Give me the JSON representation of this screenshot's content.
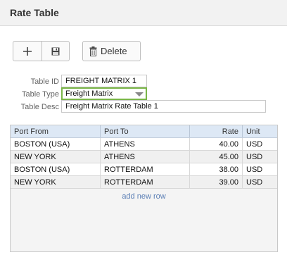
{
  "window": {
    "title": "Rate Table"
  },
  "toolbar": {
    "add_icon": "plus-icon",
    "save_icon": "floppy-disk-icon",
    "delete_icon": "trash-icon",
    "delete_label": "Delete"
  },
  "form": {
    "table_id_label": "Table ID",
    "table_id_value": "FREIGHT MATRIX 1",
    "table_type_label": "Table Type",
    "table_type_value": "Freight Matrix",
    "table_desc_label": "Table Desc",
    "table_desc_value": "Freight Matrix Rate Table 1"
  },
  "grid": {
    "columns": [
      "Port From",
      "Port To",
      "Rate",
      "Unit"
    ],
    "rows": [
      {
        "port_from": "BOSTON (USA)",
        "port_to": "ATHENS",
        "rate": "40.00",
        "unit": "USD"
      },
      {
        "port_from": "NEW YORK",
        "port_to": "ATHENS",
        "rate": "45.00",
        "unit": "USD"
      },
      {
        "port_from": "BOSTON (USA)",
        "port_to": "ROTTERDAM",
        "rate": "38.00",
        "unit": "USD"
      },
      {
        "port_from": "NEW YORK",
        "port_to": "ROTTERDAM",
        "rate": "39.00",
        "unit": "USD"
      }
    ],
    "add_row_label": "add new row"
  },
  "colors": {
    "header_bg": "#dde8f5",
    "select_border": "#7ab648",
    "link": "#5b7fb5"
  }
}
